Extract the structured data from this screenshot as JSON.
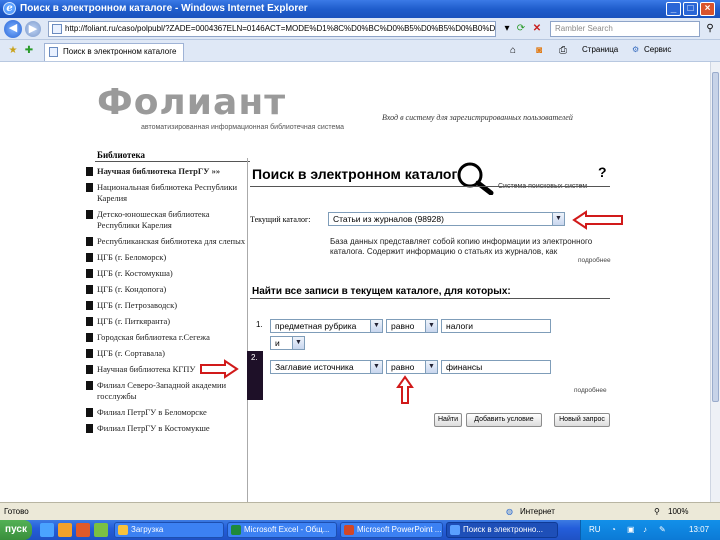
{
  "window": {
    "title": "Поиск в электронном каталоге - Windows Internet Explorer",
    "min": "_",
    "max": "□",
    "close": "×"
  },
  "toolbar": {
    "back": "◀",
    "forward": "▶",
    "address": "http://foliant.ru/caso/polpubl/?ZADE=0004367ELN=0146ACT=MODE%D1%8C%D0%BC%D0%B5%D0%B5%D0%B0%D0%D0",
    "go": "→",
    "search_placeholder": "Rambler Search"
  },
  "tabs": {
    "active_tab": "Поиск в электронном каталоге",
    "page": "Страница",
    "tools": "Сервис"
  },
  "header": {
    "logo_text": "Фолиант",
    "logo_subtitle": "автоматизированная информационная библиотечная система",
    "login_link": "Вход в систему для зарегистрированных пользователей"
  },
  "sidebar": {
    "heading": "Библиотека",
    "items": [
      {
        "label": "Научная библиотека ПетрГУ »»"
      },
      {
        "label": "Национальная библиотека Республики Карелия"
      },
      {
        "label": "Детско-юношеская библиотека Республики Карелия"
      },
      {
        "label": "Республиканская библиотека для слепых"
      },
      {
        "label": "ЦГБ (г. Беломорск)"
      },
      {
        "label": "ЦГБ (г. Костомукша)"
      },
      {
        "label": "ЦГБ (г. Кондопога)"
      },
      {
        "label": "ЦГБ (г. Петрозаводск)"
      },
      {
        "label": "ЦГБ (г. Питкяранта)"
      },
      {
        "label": "Городская библиотека г.Сегежа"
      },
      {
        "label": "ЦГБ (г. Сортавала)"
      },
      {
        "label": "Научная библиотека КГПУ"
      },
      {
        "label": "Филиал Северо-Западной академии госслужбы"
      },
      {
        "label": "Филиал ПетрГУ в Беломорске"
      },
      {
        "label": "Филиал ПетрГУ в Костомукше"
      }
    ]
  },
  "search_page": {
    "title": "Поиск в электронном каталоге",
    "help": "?",
    "system_hint": "Система поисковых систем",
    "current_catalog_label": "Текущий каталог:",
    "current_catalog_value": "Статьи из журналов (98928)",
    "catalog_description": "База данных представляет собой копию информации из электронного каталога. Содержит информацию о статьях из журналов, как",
    "more": "подробнее",
    "find_heading": "Найти все записи в текущем каталоге, для которых:",
    "rows": [
      {
        "num": "1.",
        "field": "предметная рубрика",
        "condition": "равно",
        "value": "налоги",
        "logic": "и"
      },
      {
        "num": "2.",
        "field": "Заглавие источника",
        "condition": "равно",
        "value": "финансы"
      }
    ],
    "more2": "подробнее",
    "buttons": {
      "find": "Найти",
      "add_condition": "Добавить условие",
      "new_query": "Новый запрос"
    }
  },
  "statusbar": {
    "status": "Готово",
    "zone": "Интернет",
    "zoom": "100%"
  },
  "taskbar": {
    "start": "пуск",
    "tasks": [
      {
        "label": "Загрузка"
      },
      {
        "label": "Microsoft Excel - Общ..."
      },
      {
        "label": "Microsoft PowerPoint ..."
      },
      {
        "label": "Поиск в электронно..."
      }
    ],
    "lang": "RU",
    "time": "13:07"
  },
  "colors": {
    "annotation_arrow": "#d11a1a",
    "titlebar": "#245edb",
    "row_marker": "#1e1028"
  }
}
